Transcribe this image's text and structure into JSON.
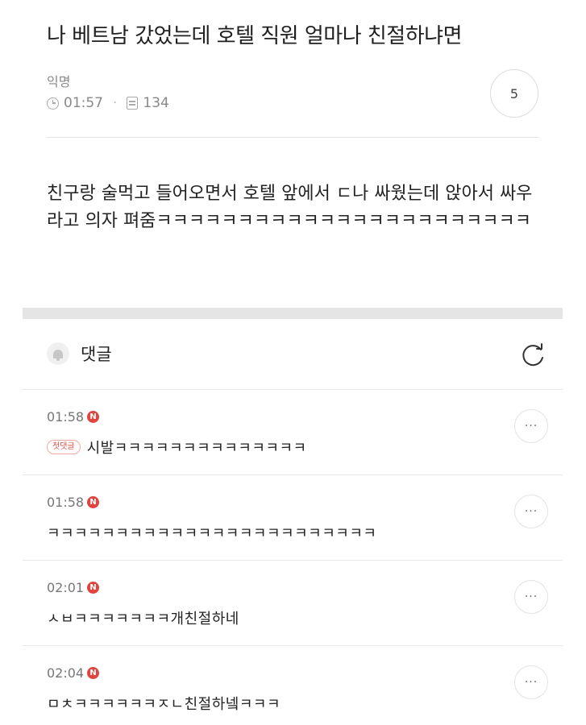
{
  "post": {
    "title": "나 베트남 갔었는데 호텔 직원 얼마나 친절하냐면",
    "author": "익명",
    "time": "01:57",
    "views": "134",
    "comment_count": "5",
    "body": "친구랑 술먹고 들어오면서 호텔 앞에서 ㄷ나 싸웠는데 앉아서 싸우라고 의자 펴줌ㅋㅋㅋㅋㅋㅋㅋㅋㅋㅋㅋㅋㅋㅋㅋㅋㅋㅋㅋㅋㅋㅋㅋ"
  },
  "comments_section": {
    "title": "댓글"
  },
  "comments": [
    {
      "time": "01:58",
      "badge": "N",
      "tag": "첫댓글",
      "text": "시발ㅋㅋㅋㅋㅋㅋㅋㅋㅋㅋㅋㅋㅋㅋ",
      "more": "···"
    },
    {
      "time": "01:58",
      "badge": "N",
      "tag": "",
      "text": "ㅋㅋㅋㅋㅋㅋㅋㅋㅋㅋㅋㅋㅋㅋㅋㅋㅋㅋㅋㅋㅋㅋㅋㅋ",
      "more": "···"
    },
    {
      "time": "02:01",
      "badge": "N",
      "tag": "",
      "text": "ㅅㅂㅋㅋㅋㅋㅋㅋㅋ개친절하네",
      "more": "···"
    },
    {
      "time": "02:04",
      "badge": "N",
      "tag": "",
      "text": "ㅁㅊㅋㅋㅋㅋㅋㅋㅈㄴ친절하넼ㅋㅋㅋ",
      "more": "···"
    }
  ],
  "colors": {
    "badge": "#e0443e",
    "tag_border": "#f1a6a6",
    "section_bar": "#e5e5e5"
  },
  "icons": [
    "clock-icon",
    "document-icon",
    "bell-icon",
    "refresh-icon",
    "more-icon"
  ]
}
